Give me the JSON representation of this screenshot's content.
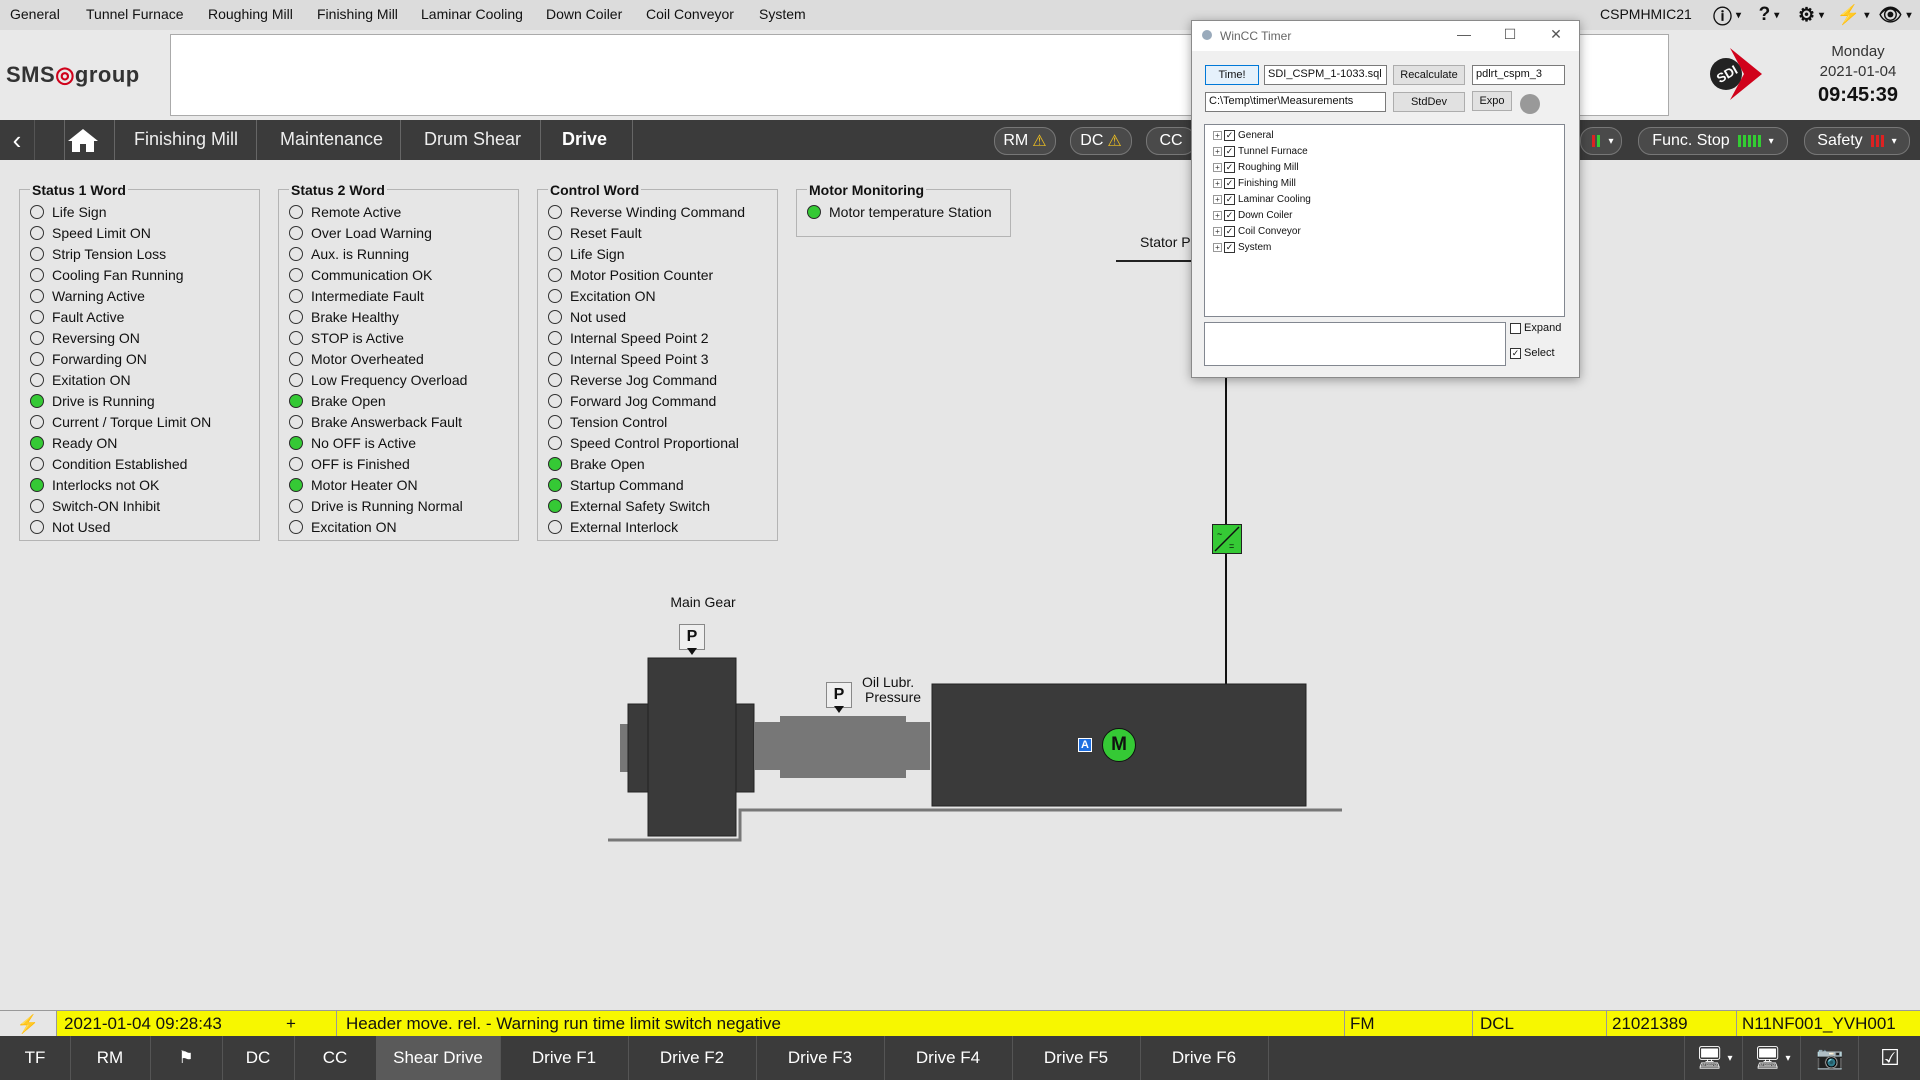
{
  "top_menu": {
    "items": [
      "General",
      "Tunnel Furnace",
      "Roughing Mill",
      "Finishing Mill",
      "Laminar Cooling",
      "Down Coiler",
      "Coil Conveyor",
      "System"
    ],
    "hostname": "CSPMHMIC21"
  },
  "header": {
    "logo_text_left": "SMS",
    "logo_text_right": "group",
    "day": "Monday",
    "date": "2021-01-04",
    "time": "09:45:39"
  },
  "breadcrumb": {
    "items": [
      "Finishing Mill",
      "Maintenance",
      "Drum Shear",
      "Drive"
    ]
  },
  "status_pills": {
    "rm": "RM",
    "dc": "DC",
    "cc": "CC",
    "func_stop": "Func. Stop",
    "safety": "Safety"
  },
  "status1": {
    "title": "Status 1 Word",
    "items": [
      {
        "label": "Life Sign",
        "on": false
      },
      {
        "label": "Speed Limit ON",
        "on": false
      },
      {
        "label": "Strip Tension Loss",
        "on": false
      },
      {
        "label": "Cooling Fan Running",
        "on": false
      },
      {
        "label": "Warning Active",
        "on": false
      },
      {
        "label": "Fault Active",
        "on": false
      },
      {
        "label": "Reversing ON",
        "on": false
      },
      {
        "label": "Forwarding ON",
        "on": false
      },
      {
        "label": "Exitation ON",
        "on": false
      },
      {
        "label": "Drive is Running",
        "on": true
      },
      {
        "label": "Current / Torque Limit ON",
        "on": false
      },
      {
        "label": "Ready ON",
        "on": true
      },
      {
        "label": "Condition Established",
        "on": false
      },
      {
        "label": "Interlocks not OK",
        "on": true
      },
      {
        "label": "Switch-ON Inhibit",
        "on": false
      },
      {
        "label": "Not Used",
        "on": false
      }
    ]
  },
  "status2": {
    "title": "Status 2 Word",
    "items": [
      {
        "label": "Remote Active",
        "on": false
      },
      {
        "label": "Over Load Warning",
        "on": false
      },
      {
        "label": "Aux. is Running",
        "on": false
      },
      {
        "label": "Communication OK",
        "on": false
      },
      {
        "label": "Intermediate Fault",
        "on": false
      },
      {
        "label": "Brake Healthy",
        "on": false
      },
      {
        "label": "STOP is Active",
        "on": false
      },
      {
        "label": "Motor Overheated",
        "on": false
      },
      {
        "label": "Low Frequency Overload",
        "on": false
      },
      {
        "label": "Brake Open",
        "on": true
      },
      {
        "label": "Brake Answerback Fault",
        "on": false
      },
      {
        "label": "No OFF is Active",
        "on": true
      },
      {
        "label": "OFF is Finished",
        "on": false
      },
      {
        "label": "Motor Heater ON",
        "on": true
      },
      {
        "label": "Drive is Running Normal",
        "on": false
      },
      {
        "label": "Excitation ON",
        "on": false
      }
    ]
  },
  "control_word": {
    "title": "Control Word",
    "items": [
      {
        "label": "Reverse Winding Command",
        "on": false
      },
      {
        "label": "Reset Fault",
        "on": false
      },
      {
        "label": "Life Sign",
        "on": false
      },
      {
        "label": "Motor Position Counter",
        "on": false
      },
      {
        "label": "Excitation ON",
        "on": false
      },
      {
        "label": "Not used",
        "on": false
      },
      {
        "label": "Internal Speed Point 2",
        "on": false
      },
      {
        "label": "Internal Speed Point 3",
        "on": false
      },
      {
        "label": "Reverse Jog Command",
        "on": false
      },
      {
        "label": "Forward Jog Command",
        "on": false
      },
      {
        "label": "Tension Control",
        "on": false
      },
      {
        "label": "Speed Control Proportional",
        "on": false
      },
      {
        "label": "Brake Open",
        "on": true
      },
      {
        "label": "Startup Command",
        "on": true
      },
      {
        "label": "External Safety Switch",
        "on": true
      },
      {
        "label": "External Interlock",
        "on": false
      }
    ]
  },
  "motor_monitoring": {
    "title": "Motor Monitoring",
    "items": [
      {
        "label": "Motor temperature Station",
        "on": true
      }
    ]
  },
  "diagram": {
    "stator_label": "Stator P",
    "main_gear_label": "Main Gear",
    "oil_label_line1": "Oil Lubr.",
    "oil_label_line2": "Pressure",
    "p_symbol": "P",
    "auto_badge": "A",
    "motor_symbol": "M"
  },
  "alarm": {
    "timestamp": "2021-01-04 09:28:43",
    "sign": "+",
    "message": "Header move. rel. - Warning run time limit switch negative",
    "area": "FM",
    "plc": "DCL",
    "number": "21021389",
    "tag": "N11NF001_YVH001"
  },
  "bottom_tabs": {
    "items": [
      "TF",
      "RM",
      "",
      "DC",
      "CC",
      "Shear Drive",
      "Drive F1",
      "Drive F2",
      "Drive F3",
      "Drive F4",
      "Drive F5",
      "Drive F6"
    ],
    "active": "Shear Drive"
  },
  "dialog": {
    "title": "WinCC Timer",
    "time_button": "Time!",
    "sql_file": "SDI_CSPM_1-1033.sql",
    "recalculate_button": "Recalculate",
    "db_name": "pdlrt_cspm_3",
    "path": "C:\\Temp\\timer\\Measurements",
    "stddev_button": "StdDev",
    "expo_button": "Expo",
    "tree": [
      "General",
      "Tunnel Furnace",
      "Roughing Mill",
      "Finishing Mill",
      "Laminar Cooling",
      "Down Coiler",
      "Coil Conveyor",
      "System"
    ],
    "expand_label": "Expand",
    "select_label": "Select"
  },
  "colors": {
    "lamp_on": "#35c935",
    "alarm_bg": "#f7f700",
    "nav_bg": "#3b3b3b",
    "sdi_red": "#d0021b"
  }
}
